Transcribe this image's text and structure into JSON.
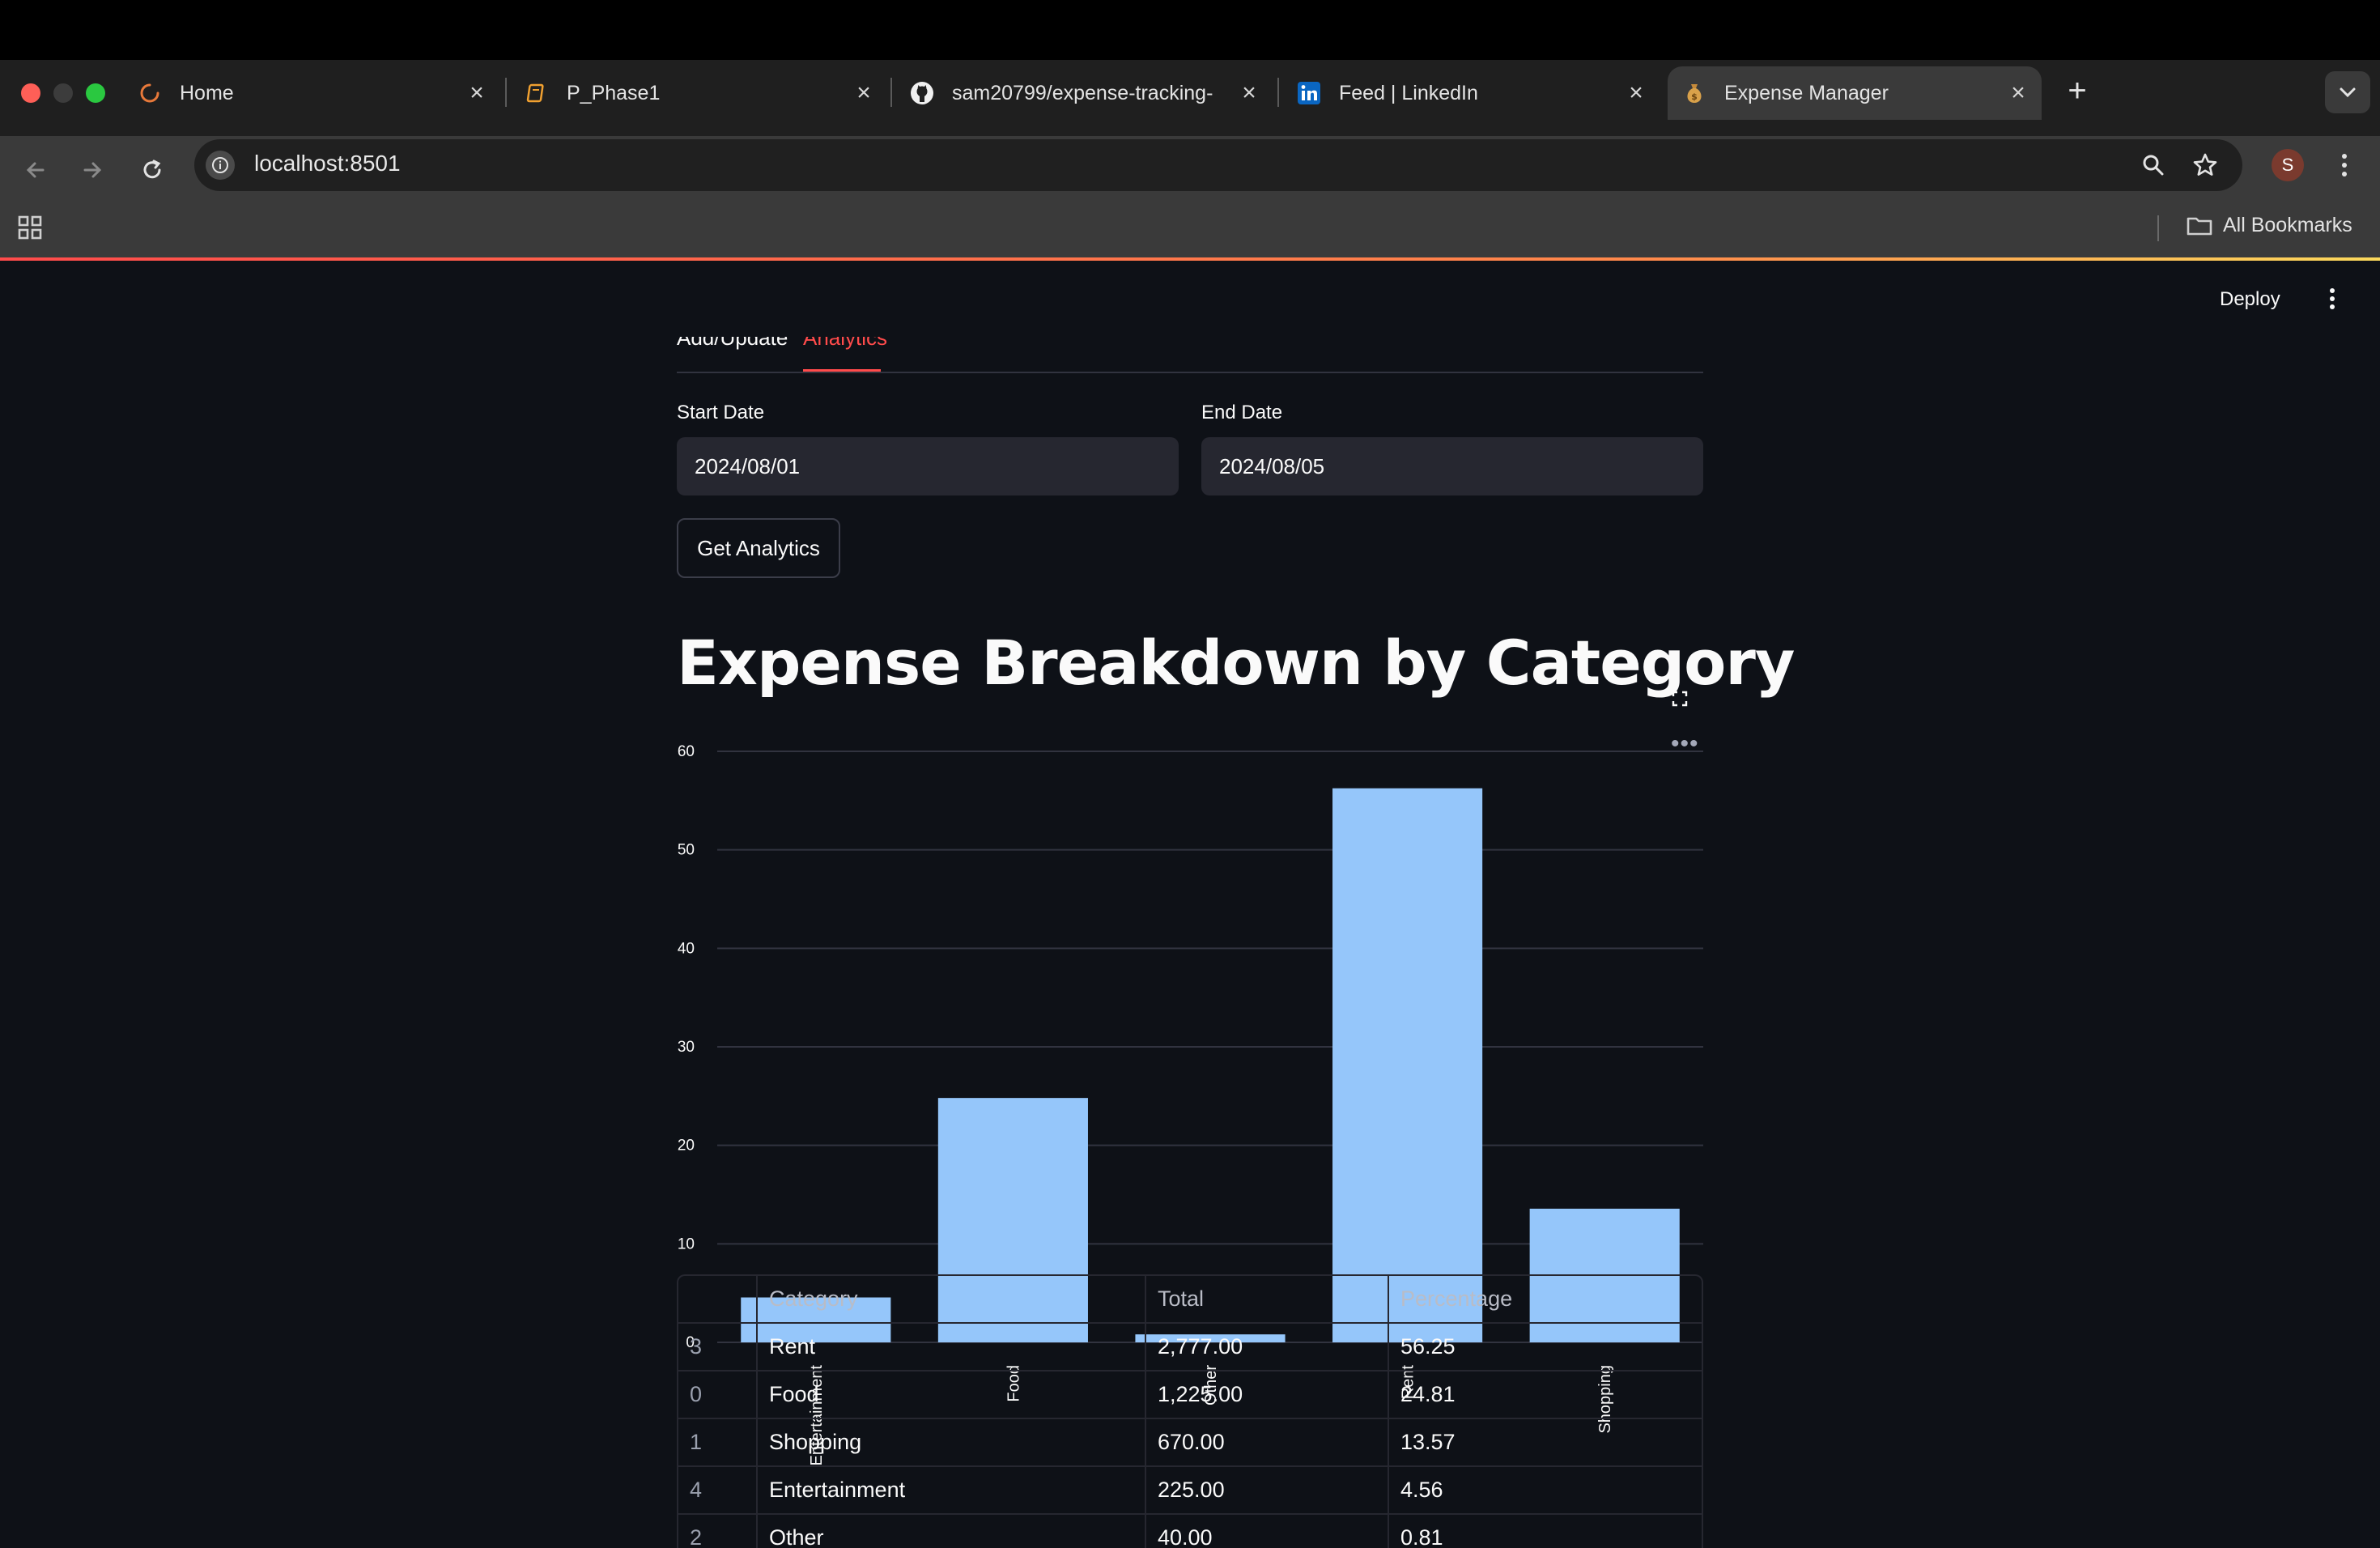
{
  "browser": {
    "tabs": [
      {
        "title": "Home",
        "icon": "loading-spinner-icon"
      },
      {
        "title": "P_Phase1",
        "icon": "notebook-icon"
      },
      {
        "title": "sam20799/expense-tracking-",
        "icon": "github-icon"
      },
      {
        "title": "Feed | LinkedIn",
        "icon": "linkedin-icon"
      },
      {
        "title": "Expense Manager",
        "icon": "money-bag-icon"
      }
    ],
    "active_tab_index": 4,
    "url": "localhost:8501",
    "profile_initial": "S",
    "bookmarks_label": "All Bookmarks"
  },
  "app": {
    "deploy_label": "Deploy",
    "tabs": [
      "Add/Update",
      "Analytics"
    ],
    "active_tab": "Analytics",
    "start_date_label": "Start Date",
    "start_date_value": "2024/08/01",
    "end_date_label": "End Date",
    "end_date_value": "2024/08/05",
    "button_label": "Get Analytics",
    "heading": "Expense Breakdown by Category"
  },
  "chart_data": {
    "type": "bar",
    "categories": [
      "Entertainment",
      "Food",
      "Other",
      "Rent",
      "Shopping"
    ],
    "values": [
      4.56,
      24.81,
      0.81,
      56.25,
      13.57
    ],
    "title": "",
    "xlabel": "",
    "ylabel": "",
    "ylim": [
      0,
      60
    ],
    "yticks": [
      0,
      10,
      20,
      30,
      40,
      50,
      60
    ],
    "grid": true,
    "bar_color": "#95c6fa"
  },
  "table": {
    "columns": [
      "",
      "Category",
      "Total",
      "Percentage"
    ],
    "rows": [
      [
        "3",
        "Rent",
        "2,777.00",
        "56.25"
      ],
      [
        "0",
        "Food",
        "1,225.00",
        "24.81"
      ],
      [
        "1",
        "Shopping",
        "670.00",
        "13.57"
      ],
      [
        "4",
        "Entertainment",
        "225.00",
        "4.56"
      ],
      [
        "2",
        "Other",
        "40.00",
        "0.81"
      ]
    ]
  },
  "colors": {
    "app_background": "#0e1117",
    "accent": "#ff4b4b",
    "input_background": "#262730"
  }
}
